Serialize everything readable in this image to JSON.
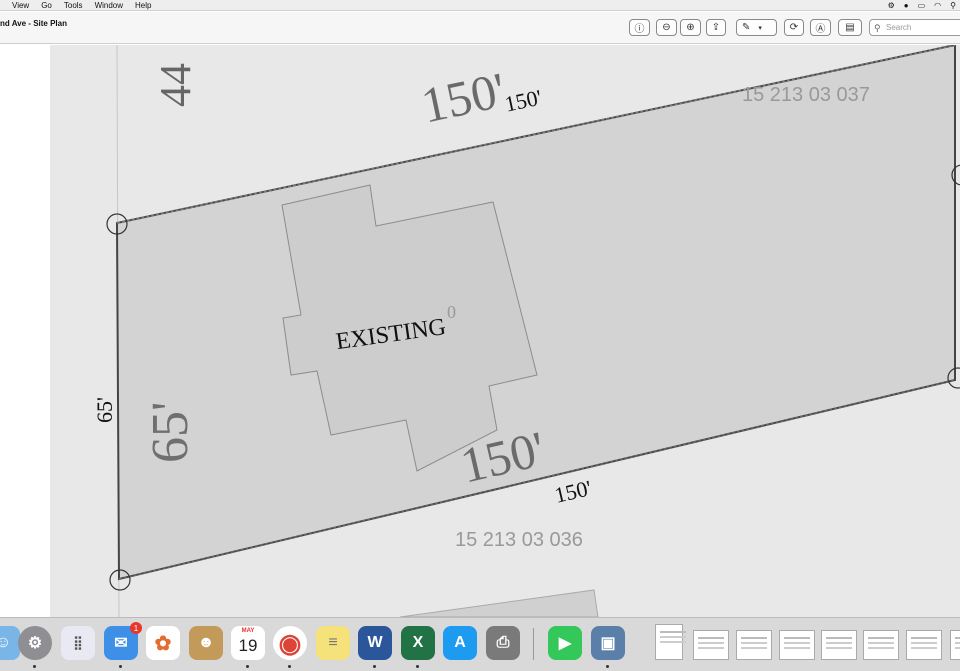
{
  "menubar": {
    "items": [
      "View",
      "Go",
      "Tools",
      "Window",
      "Help"
    ]
  },
  "window": {
    "title": "nd Ave - Site Plan",
    "search_placeholder": "Search"
  },
  "site_plan": {
    "top_label_large": "150'",
    "top_label_small": "150'",
    "bottom_label_large": "150'",
    "bottom_label_small": "150'",
    "side_label_large": "65'",
    "side_label_small": "65'",
    "corner_number": "44",
    "parcel_north": "15 213 03 037",
    "parcel_south": "15 213 03 036",
    "building_label": "EXISTING",
    "building_suffix": "0"
  },
  "dock": {
    "mail_badge": "1",
    "calendar_month": "MAY",
    "calendar_day": "19",
    "word_letter": "W",
    "excel_letter": "X"
  }
}
